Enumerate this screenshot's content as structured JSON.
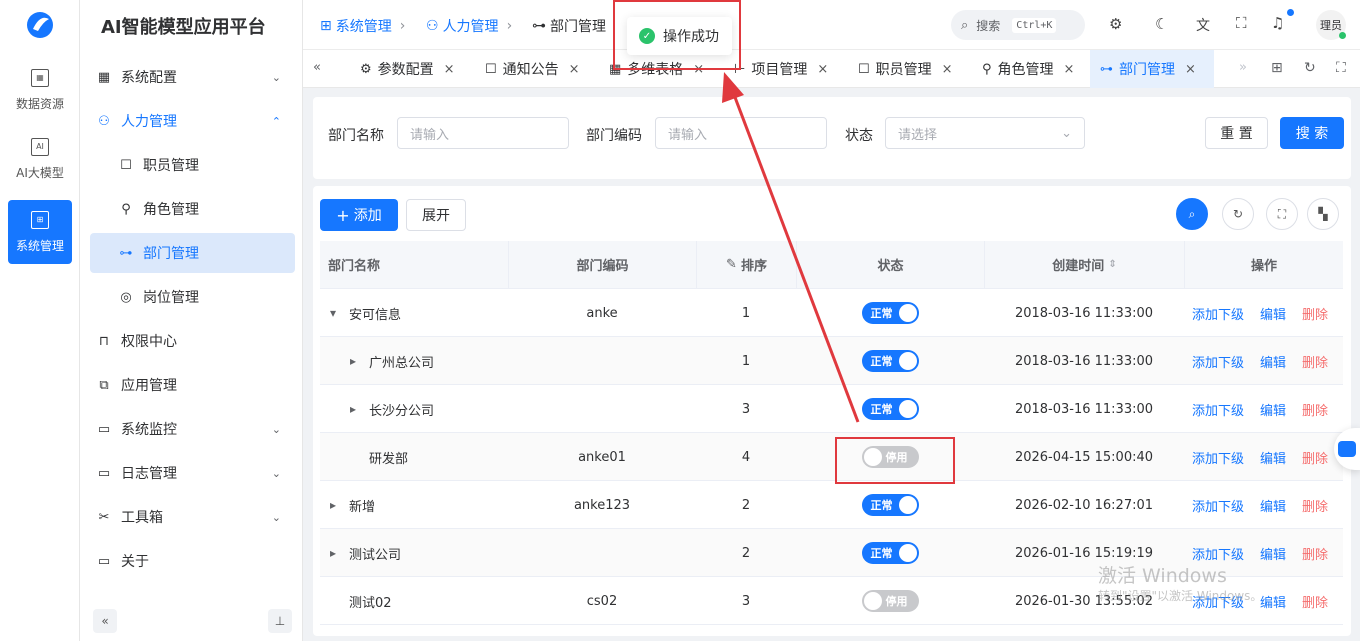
{
  "app": {
    "title": "AI智能模型应用平台"
  },
  "rail": [
    {
      "label": "数据资源"
    },
    {
      "label": "AI大模型"
    },
    {
      "label": "系统管理"
    }
  ],
  "menu": {
    "system_config": "系统配置",
    "hr": "人力管理",
    "staff": "职员管理",
    "role": "角色管理",
    "dept": "部门管理",
    "post": "岗位管理",
    "perm": "权限中心",
    "app": "应用管理",
    "monitor": "系统监控",
    "log": "日志管理",
    "tools": "工具箱",
    "about": "关于"
  },
  "breadcrumb": [
    "系统管理",
    "人力管理",
    "部门管理"
  ],
  "header": {
    "search_label": "搜索",
    "shortcut": "Ctrl+K",
    "user": "理员"
  },
  "toast": {
    "text": "操作成功"
  },
  "tabs": [
    "参数配置",
    "通知公告",
    "多维表格",
    "项目管理",
    "职员管理",
    "角色管理",
    "部门管理"
  ],
  "search": {
    "name_label": "部门名称",
    "name_placeholder": "请输入",
    "code_label": "部门编码",
    "code_placeholder": "请输入",
    "status_label": "状态",
    "status_placeholder": "请选择",
    "reset": "重 置",
    "submit": "搜 索"
  },
  "toolbar": {
    "add": "添加",
    "expand": "展开"
  },
  "table": {
    "headers": [
      "部门名称",
      "部门编码",
      "排序",
      "状态",
      "创建时间",
      "操作"
    ],
    "status_on": "正常",
    "status_off": "停用",
    "ops": [
      "添加下级",
      "编辑",
      "删除"
    ],
    "rows": [
      {
        "name": "安可信息",
        "code": "anke",
        "sort": "1",
        "on": true,
        "time": "2018-03-16 11:33:00",
        "indent": 0,
        "toggle": "down"
      },
      {
        "name": "广州总公司",
        "code": "",
        "sort": "1",
        "on": true,
        "time": "2018-03-16 11:33:00",
        "indent": 1,
        "toggle": "right"
      },
      {
        "name": "长沙分公司",
        "code": "",
        "sort": "3",
        "on": true,
        "time": "2018-03-16 11:33:00",
        "indent": 1,
        "toggle": "right"
      },
      {
        "name": "研发部",
        "code": "anke01",
        "sort": "4",
        "on": false,
        "time": "2026-04-15 15:00:40",
        "indent": 1,
        "toggle": ""
      },
      {
        "name": "新增",
        "code": "anke123",
        "sort": "2",
        "on": true,
        "time": "2026-02-10 16:27:01",
        "indent": 0,
        "toggle": "right"
      },
      {
        "name": "测试公司",
        "code": "",
        "sort": "2",
        "on": true,
        "time": "2026-01-16 15:19:19",
        "indent": 0,
        "toggle": "right"
      },
      {
        "name": "测试02",
        "code": "cs02",
        "sort": "3",
        "on": false,
        "time": "2026-01-30 13:55:02",
        "indent": 0,
        "toggle": ""
      }
    ]
  },
  "watermark": {
    "line1": "激活 Windows",
    "line2": "转到\"设置\"以激活 Windows。"
  },
  "colors": {
    "primary": "#1677ff",
    "danger": "#f56c6c",
    "annotation": "#e0393e"
  }
}
